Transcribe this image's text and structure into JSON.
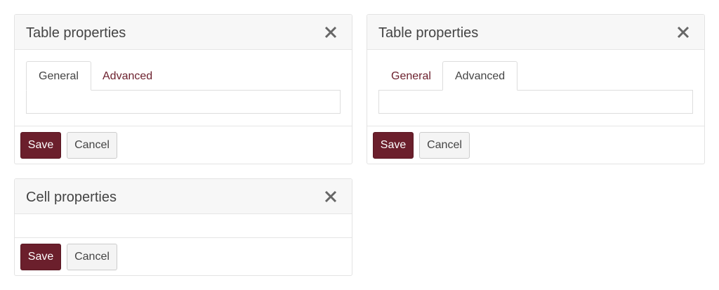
{
  "dialogs": [
    {
      "title": "Table properties",
      "tabs": [
        {
          "label": "General",
          "active": true
        },
        {
          "label": "Advanced",
          "active": false
        }
      ],
      "save_label": "Save",
      "cancel_label": "Cancel",
      "close_icon": "close-icon"
    },
    {
      "title": "Table properties",
      "tabs": [
        {
          "label": "General",
          "active": false
        },
        {
          "label": "Advanced",
          "active": true
        }
      ],
      "save_label": "Save",
      "cancel_label": "Cancel",
      "close_icon": "close-icon"
    },
    {
      "title": "Cell properties",
      "save_label": "Save",
      "cancel_label": "Cancel",
      "close_icon": "close-icon"
    }
  ],
  "colors": {
    "accent": "#6b1f2c",
    "header_bg": "#f7f7f7",
    "border": "#e3e3e3"
  }
}
